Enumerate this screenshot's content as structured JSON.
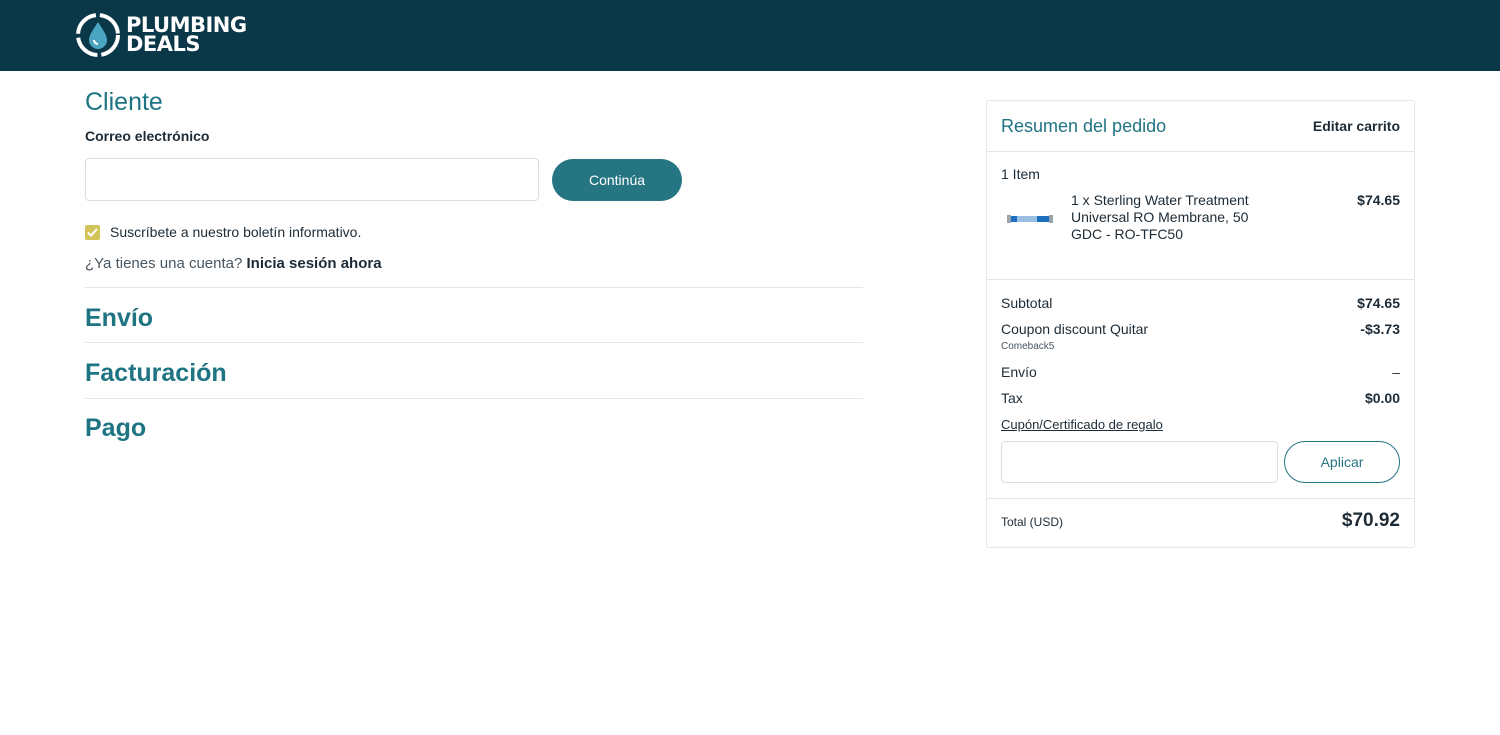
{
  "header": {
    "logo_line1": "PLUMBING",
    "logo_line2": "DEALS"
  },
  "customer": {
    "title": "Cliente",
    "email_label": "Correo electrónico",
    "email_value": "",
    "continue_button": "Continúa",
    "newsletter_label": "Suscríbete a nuestro boletín informativo.",
    "newsletter_checked": true,
    "account_question": "¿Ya tienes una cuenta?",
    "signin_link": "Inicia sesión ahora"
  },
  "sections": {
    "shipping": "Envío",
    "billing": "Facturación",
    "payment": "Pago"
  },
  "summary": {
    "title": "Resumen del pedido",
    "edit_cart": "Editar carrito",
    "item_count": "1 Item",
    "item": {
      "description": "1 x Sterling Water Treatment Universal RO Membrane, 50 GDC - RO-TFC50",
      "price": "$74.65"
    },
    "subtotal_label": "Subtotal",
    "subtotal_value": "$74.65",
    "coupon_label": "Coupon discount",
    "coupon_remove": "Quitar",
    "coupon_code": "Comeback5",
    "coupon_value": "-$3.73",
    "shipping_label": "Envío",
    "shipping_value": "–",
    "tax_label": "Tax",
    "tax_value": "$0.00",
    "gift_link": "Cupón/Certificado de regalo",
    "gift_input_value": "",
    "apply_button": "Aplicar",
    "total_label": "Total (USD)",
    "total_value": "$70.92"
  },
  "colors": {
    "header_bg": "#0b3848",
    "accent_teal": "#267583",
    "heading_teal": "#1f7483",
    "checkbox_yellow": "#d3c45a"
  }
}
